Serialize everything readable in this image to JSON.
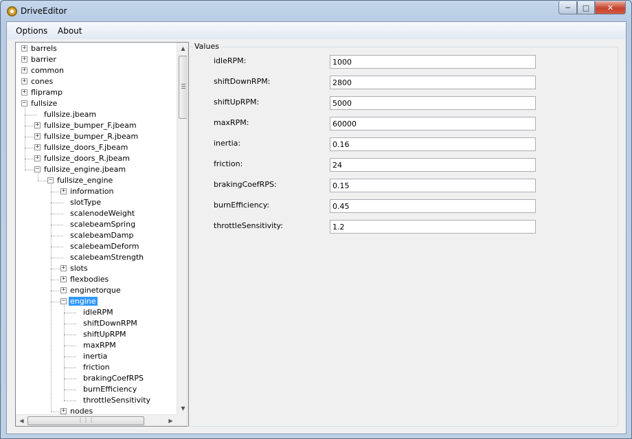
{
  "window": {
    "title": "DriveEditor"
  },
  "menu": [
    "Options",
    "About"
  ],
  "tree": {
    "items": [
      {
        "label": "barrels",
        "level": 0,
        "expander": "+"
      },
      {
        "label": "barrier",
        "level": 0,
        "expander": "+"
      },
      {
        "label": "common",
        "level": 0,
        "expander": "+"
      },
      {
        "label": "cones",
        "level": 0,
        "expander": "+"
      },
      {
        "label": "flipramp",
        "level": 0,
        "expander": "+"
      },
      {
        "label": "fullsize",
        "level": 0,
        "expander": "-"
      },
      {
        "label": "fullsize.jbeam",
        "level": 1,
        "expander": ""
      },
      {
        "label": "fullsize_bumper_F.jbeam",
        "level": 1,
        "expander": "+"
      },
      {
        "label": "fullsize_bumper_R.jbeam",
        "level": 1,
        "expander": "+"
      },
      {
        "label": "fullsize_doors_F.jbeam",
        "level": 1,
        "expander": "+"
      },
      {
        "label": "fullsize_doors_R.jbeam",
        "level": 1,
        "expander": "+"
      },
      {
        "label": "fullsize_engine.jbeam",
        "level": 1,
        "expander": "-"
      },
      {
        "label": "fullsize_engine",
        "level": 2,
        "expander": "-"
      },
      {
        "label": "information",
        "level": 3,
        "expander": "+"
      },
      {
        "label": "slotType",
        "level": 3,
        "expander": ""
      },
      {
        "label": "scalenodeWeight",
        "level": 3,
        "expander": ""
      },
      {
        "label": "scalebeamSpring",
        "level": 3,
        "expander": ""
      },
      {
        "label": "scalebeamDamp",
        "level": 3,
        "expander": ""
      },
      {
        "label": "scalebeamDeform",
        "level": 3,
        "expander": ""
      },
      {
        "label": "scalebeamStrength",
        "level": 3,
        "expander": ""
      },
      {
        "label": "slots",
        "level": 3,
        "expander": "+"
      },
      {
        "label": "flexbodies",
        "level": 3,
        "expander": "+"
      },
      {
        "label": "enginetorque",
        "level": 3,
        "expander": "+"
      },
      {
        "label": "engine",
        "level": 3,
        "expander": "-",
        "selected": true
      },
      {
        "label": "idleRPM",
        "level": 4,
        "expander": ""
      },
      {
        "label": "shiftDownRPM",
        "level": 4,
        "expander": ""
      },
      {
        "label": "shiftUpRPM",
        "level": 4,
        "expander": ""
      },
      {
        "label": "maxRPM",
        "level": 4,
        "expander": ""
      },
      {
        "label": "inertia",
        "level": 4,
        "expander": ""
      },
      {
        "label": "friction",
        "level": 4,
        "expander": ""
      },
      {
        "label": "brakingCoefRPS",
        "level": 4,
        "expander": ""
      },
      {
        "label": "burnEfficiency",
        "level": 4,
        "expander": ""
      },
      {
        "label": "throttleSensitivity",
        "level": 4,
        "expander": ""
      },
      {
        "label": "nodes",
        "level": 3,
        "expander": "+"
      }
    ]
  },
  "values": {
    "legend": "Values",
    "fields": [
      {
        "label": "idleRPM:",
        "value": "1000"
      },
      {
        "label": "shiftDownRPM:",
        "value": "2800"
      },
      {
        "label": "shiftUpRPM:",
        "value": "5000"
      },
      {
        "label": "maxRPM:",
        "value": "60000"
      },
      {
        "label": "inertia:",
        "value": "0.16"
      },
      {
        "label": "friction:",
        "value": "24"
      },
      {
        "label": "brakingCoefRPS:",
        "value": "0.15"
      },
      {
        "label": "burnEfficiency:",
        "value": "0.45"
      },
      {
        "label": "throttleSensitivity:",
        "value": "1.2"
      }
    ]
  },
  "icons": {
    "app": "gear-app-icon",
    "minimize": "minimize-icon",
    "maximize": "maximize-icon",
    "close": "close-icon"
  },
  "colors": {
    "selection": "#3399ff",
    "titlebar": "#c4d7ec",
    "close": "#c7442f"
  }
}
